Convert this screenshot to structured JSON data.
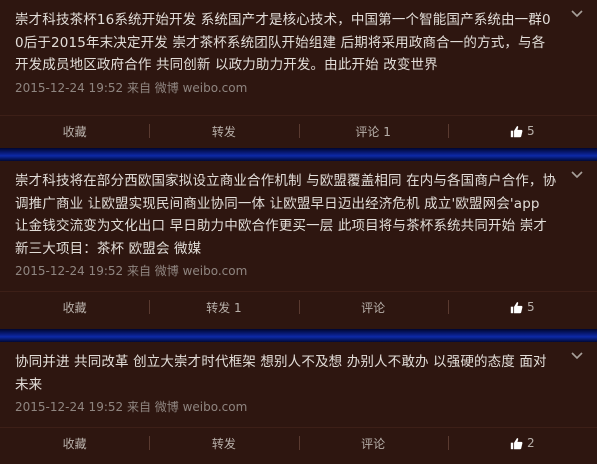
{
  "posts": [
    {
      "text": "崇才科技茶杯16系统开始开发 系统国产才是核心技术，中国第一个智能国产系统由一群00后于2015年末决定开发 崇才茶杯系统团队开始组建 后期将采用政商合一的方式，与各开发成员地区政府合作 共同创新 以政力助力开发。由此开始 改变世界",
      "meta": "2015-12-24 19:52 来自 微博 weibo.com",
      "actions": {
        "save": "收藏",
        "repost": "转发",
        "comment": "评论 1",
        "like": "5"
      }
    },
    {
      "text": "崇才科技将在部分西欧国家拟设立商业合作机制 与欧盟覆盖相同 在内与各国商户合作，协调推广商业 让欧盟实现民间商业协同一体 让欧盟早日迈出经济危机 成立'欧盟网会'app 让金钱交流变为文化出口 早日助力中欧合作更买一层 此项目将与茶杯系统共同开始 崇才新三大项目：茶杯 欧盟会 微媒",
      "meta": "2015-12-24 19:52 来自 微博 weibo.com",
      "actions": {
        "save": "收藏",
        "repost": "转发 1",
        "comment": "评论",
        "like": "5"
      }
    },
    {
      "text": "协同并进 共同改革 创立大崇才时代框架 想别人不及想 办别人不敢办 以强硬的态度 面对未来",
      "meta": "2015-12-24 19:52 来自 微博 weibo.com",
      "actions": {
        "save": "收藏",
        "repost": "转发",
        "comment": "评论",
        "like": "2"
      }
    }
  ],
  "icons": {
    "menu": "chevron-down-icon",
    "like": "thumbs-up-icon"
  },
  "colors": {
    "background": "#2e1610",
    "text": "#e2ddd8",
    "meta": "#8f8580",
    "separator": "#0d2aa8"
  }
}
